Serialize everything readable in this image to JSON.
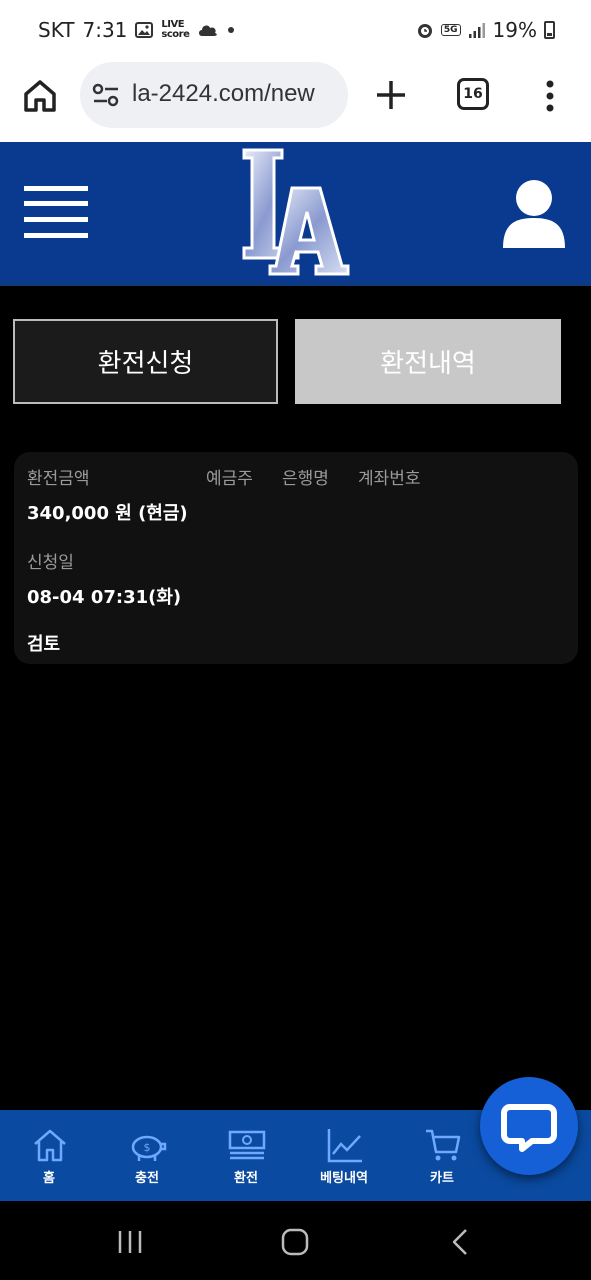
{
  "status_bar": {
    "carrier": "SKT",
    "time": "7:31",
    "live_badge_line1": "LIVE",
    "live_badge_line2": "score",
    "network": "5G",
    "battery": "19%"
  },
  "browser": {
    "url": "la-2424.com/new",
    "tab_count": "16"
  },
  "site": {
    "logo_icon": "la-logo",
    "menu_icon": "hamburger-icon",
    "profile_icon": "user-icon"
  },
  "tabs": {
    "apply": "환전신청",
    "history": "환전내역"
  },
  "card": {
    "labels": {
      "amount": "환전금액",
      "depositor": "예금주",
      "bank": "은행명",
      "account": "계좌번호",
      "date": "신청일"
    },
    "amount": "340,000 원 (현금)",
    "date": "08-04 07:31(화)",
    "status": "검토"
  },
  "bottom_nav": {
    "items": [
      {
        "label": "홈",
        "icon": "home-icon"
      },
      {
        "label": "충전",
        "icon": "piggy-bank-icon"
      },
      {
        "label": "환전",
        "icon": "money-icon"
      },
      {
        "label": "베팅내역",
        "icon": "chart-icon"
      },
      {
        "label": "카트",
        "icon": "cart-icon"
      }
    ],
    "active_index": 2
  },
  "colors": {
    "header_blue": "#0a3a8f",
    "nav_blue": "#0a4aa0",
    "fab_blue": "#1560d6"
  }
}
